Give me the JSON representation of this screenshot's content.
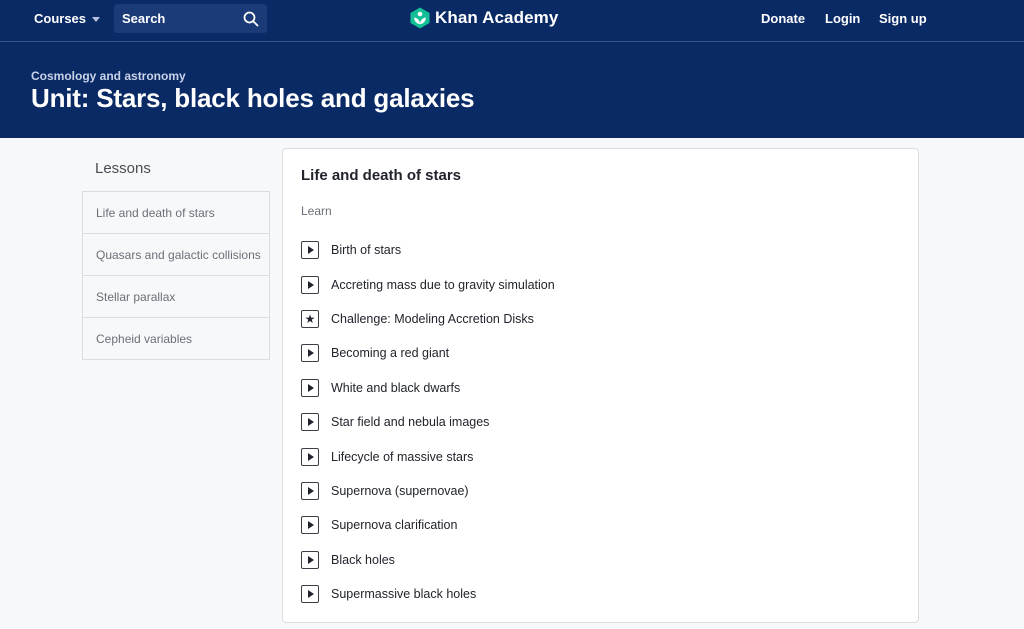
{
  "nav": {
    "courses_label": "Courses",
    "search_label": "Search",
    "logo_text": "Khan Academy",
    "donate_label": "Donate",
    "login_label": "Login",
    "signup_label": "Sign up",
    "colors": {
      "nav_bg": "#0a2a66",
      "logo_green": "#14bf96"
    }
  },
  "hero": {
    "breadcrumb": "Cosmology and astronomy",
    "title": "Unit: Stars, black holes and galaxies"
  },
  "sidebar": {
    "heading": "Lessons",
    "items": [
      {
        "label": "Life and death of stars"
      },
      {
        "label": "Quasars and galactic collisions"
      },
      {
        "label": "Stellar parallax"
      },
      {
        "label": "Cepheid variables"
      }
    ]
  },
  "main": {
    "title": "Life and death of stars",
    "section_label": "Learn",
    "items": [
      {
        "label": "Birth of stars",
        "icon": "play-icon"
      },
      {
        "label": "Accreting mass due to gravity simulation",
        "icon": "play-icon"
      },
      {
        "label": "Challenge: Modeling Accretion Disks",
        "icon": "star-icon"
      },
      {
        "label": "Becoming a red giant",
        "icon": "play-icon"
      },
      {
        "label": "White and black dwarfs",
        "icon": "play-icon"
      },
      {
        "label": "Star field and nebula images",
        "icon": "play-icon"
      },
      {
        "label": "Lifecycle of massive stars",
        "icon": "play-icon"
      },
      {
        "label": "Supernova (supernovae)",
        "icon": "play-icon"
      },
      {
        "label": "Supernova clarification",
        "icon": "play-icon"
      },
      {
        "label": "Black holes",
        "icon": "play-icon"
      },
      {
        "label": "Supermassive black holes",
        "icon": "play-icon"
      }
    ]
  }
}
